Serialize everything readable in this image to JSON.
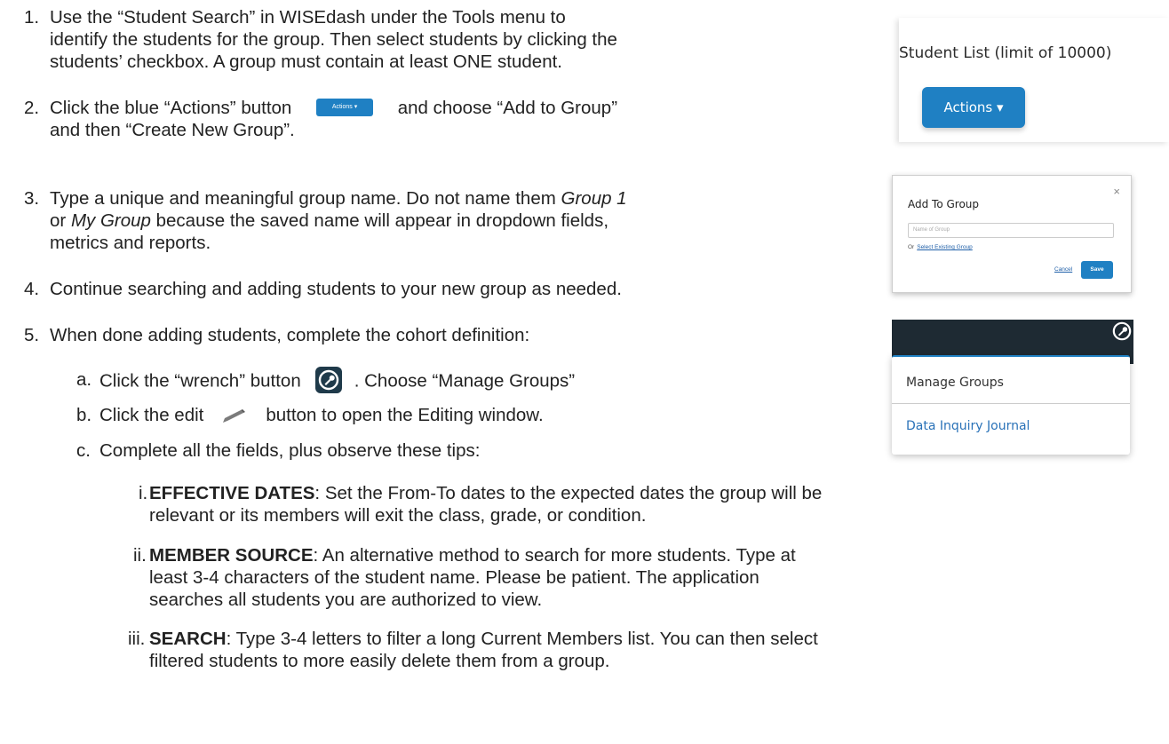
{
  "steps": {
    "s1": {
      "num": "1.",
      "line1": "Use the “Student Search” in WISEdash under the Tools menu to",
      "line2": "identify the students for the group.  Then select students by clicking the",
      "line3": "students’ checkbox. A group must contain at least ONE student."
    },
    "s2": {
      "num": "2.",
      "before": "Click the blue “Actions” button",
      "button_label": "Actions ▾",
      "after": "and choose “Add to Group”",
      "line2": "and then “Create New Group”."
    },
    "s3": {
      "num": "3.",
      "line1_a": "Type a unique and meaningful group name. Do not name them ",
      "line1_i": "Group 1",
      "line2_a": "or ",
      "line2_i": "My Group",
      "line2_b": " because the saved name will appear in dropdown fields,",
      "line3": "metrics and reports."
    },
    "s4": {
      "num": "4.",
      "line1": "Continue searching and adding students to your new group as needed."
    },
    "s5": {
      "num": "5.",
      "line1": "When done adding students, complete the cohort definition:"
    },
    "sa": {
      "letter": "a.",
      "before": "Click the “wrench” button",
      "after": ". Choose  “Manage Groups”"
    },
    "sb": {
      "letter": "b.",
      "before": "Click the edit",
      "after": "button  to open the Editing window."
    },
    "sc": {
      "letter": "c.",
      "line1": "Complete all the fields, plus observe these tips:"
    },
    "si": {
      "num": "i.",
      "label": "EFFECTIVE DATES",
      "line1": ":  Set the From-To dates to the expected dates the group will be",
      "line2": "relevant or its members will exit the class, grade, or condition."
    },
    "sii": {
      "num": "ii.",
      "label": "MEMBER SOURCE",
      "line1": ": An alternative method to search for more students. Type at",
      "line2": "least 3-4 characters of the student name. Please be patient. The application",
      "line3": "searches all students you are authorized to view."
    },
    "siii": {
      "num": "iii.",
      "label": "SEARCH",
      "line1": ": Type 3-4 letters to filter a long Current Members list. You can then select",
      "line2": "filtered students to more easily delete them from a group."
    }
  },
  "panel1": {
    "title": "Student List (limit of 10000)",
    "button": "Actions ▾"
  },
  "panel2": {
    "title": "Add To Group",
    "close": "×",
    "placeholder": "Name of Group",
    "or": "Or",
    "link": "Select Existing Group",
    "cancel": "Cancel",
    "save": "Save"
  },
  "panel3": {
    "item1": "Manage Groups",
    "item2": "Data Inquiry Journal"
  }
}
